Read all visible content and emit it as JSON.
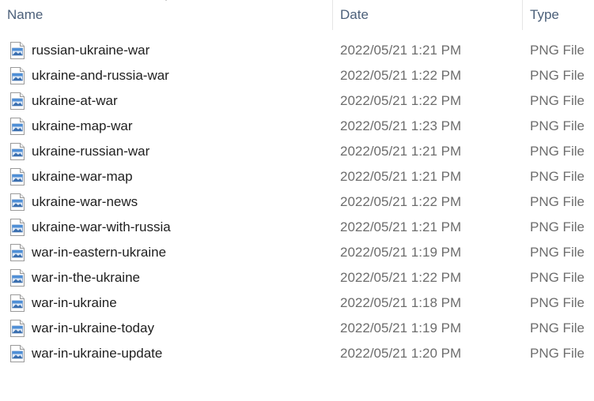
{
  "columns": {
    "name": "Name",
    "date": "Date",
    "type": "Type"
  },
  "files": [
    {
      "name": "russian-ukraine-war",
      "date": "2022/05/21 1:21 PM",
      "type": "PNG File",
      "icon": "png-file-icon"
    },
    {
      "name": "ukraine-and-russia-war",
      "date": "2022/05/21 1:22 PM",
      "type": "PNG File",
      "icon": "png-file-icon"
    },
    {
      "name": "ukraine-at-war",
      "date": "2022/05/21 1:22 PM",
      "type": "PNG File",
      "icon": "png-file-icon"
    },
    {
      "name": "ukraine-map-war",
      "date": "2022/05/21 1:23 PM",
      "type": "PNG File",
      "icon": "png-file-icon"
    },
    {
      "name": "ukraine-russian-war",
      "date": "2022/05/21 1:21 PM",
      "type": "PNG File",
      "icon": "png-file-icon"
    },
    {
      "name": "ukraine-war-map",
      "date": "2022/05/21 1:21 PM",
      "type": "PNG File",
      "icon": "png-file-icon"
    },
    {
      "name": "ukraine-war-news",
      "date": "2022/05/21 1:22 PM",
      "type": "PNG File",
      "icon": "png-file-icon"
    },
    {
      "name": "ukraine-war-with-russia",
      "date": "2022/05/21 1:21 PM",
      "type": "PNG File",
      "icon": "png-file-icon"
    },
    {
      "name": "war-in-eastern-ukraine",
      "date": "2022/05/21 1:19 PM",
      "type": "PNG File",
      "icon": "png-file-icon"
    },
    {
      "name": "war-in-the-ukraine",
      "date": "2022/05/21 1:22 PM",
      "type": "PNG File",
      "icon": "png-file-icon"
    },
    {
      "name": "war-in-ukraine",
      "date": "2022/05/21 1:18 PM",
      "type": "PNG File",
      "icon": "png-file-icon"
    },
    {
      "name": "war-in-ukraine-today",
      "date": "2022/05/21 1:19 PM",
      "type": "PNG File",
      "icon": "png-file-icon"
    },
    {
      "name": "war-in-ukraine-update",
      "date": "2022/05/21 1:20 PM",
      "type": "PNG File",
      "icon": "png-file-icon"
    }
  ]
}
